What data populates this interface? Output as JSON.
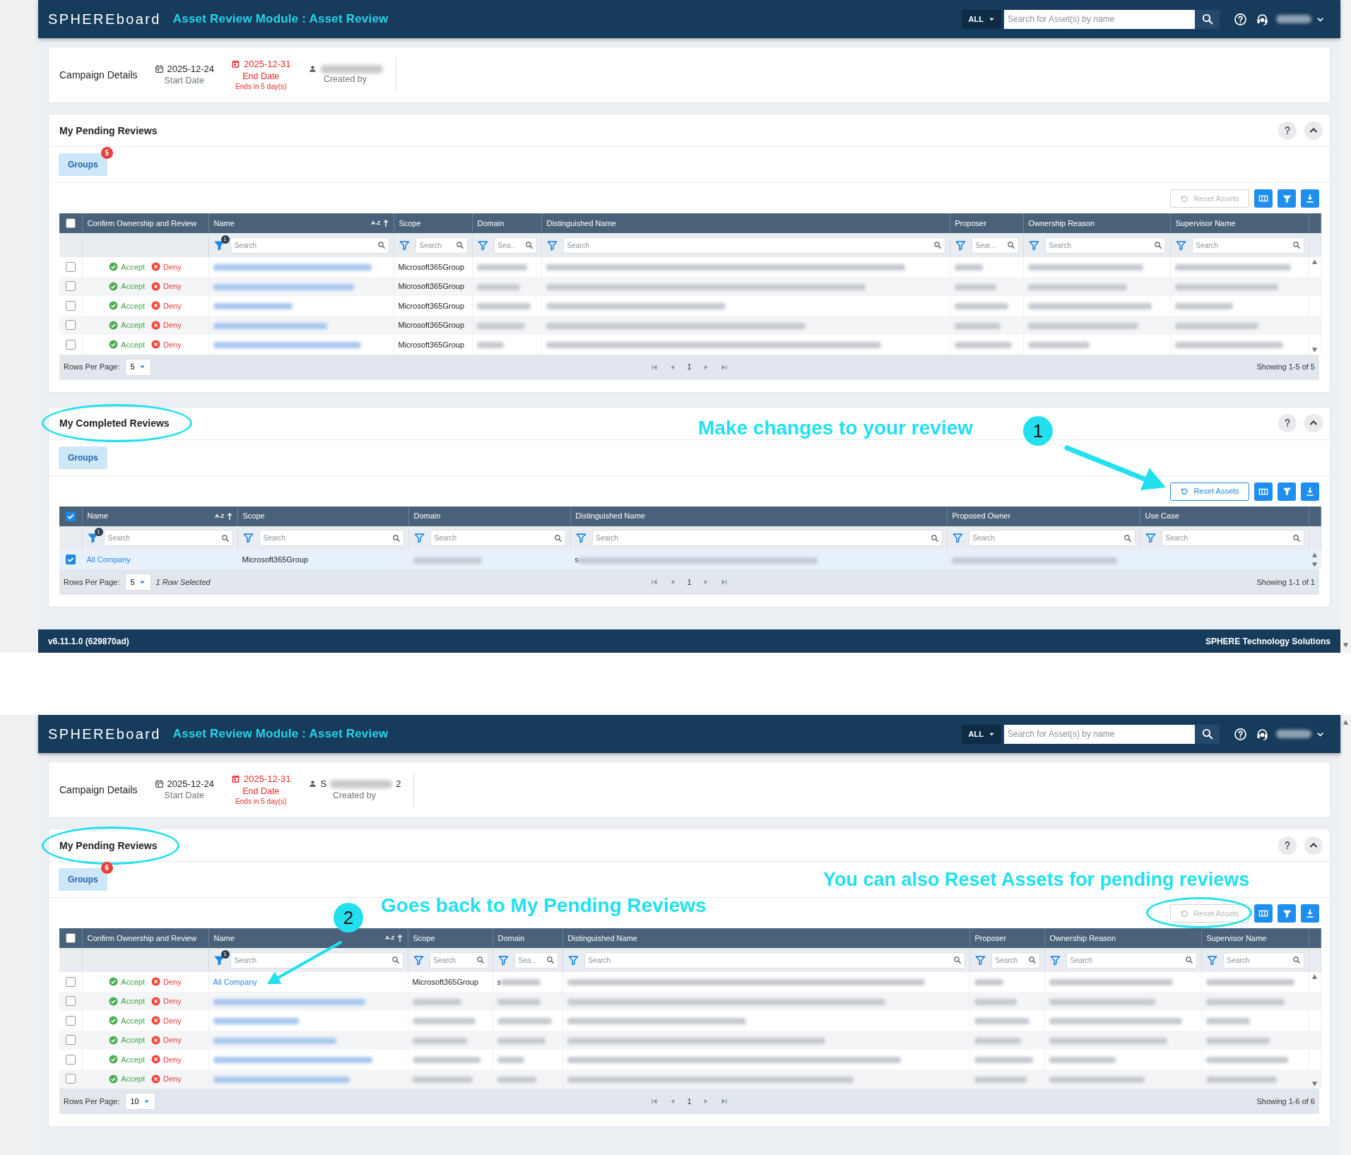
{
  "screens": [
    {
      "header": {
        "logo": "SPHEREboard",
        "module_title": "Asset Review Module : Asset Review",
        "scope": "ALL",
        "search": {
          "placeholder": "Search for Asset(s) by name"
        },
        "user": {
          "redacted": true
        }
      },
      "campaign": {
        "title": "Campaign Details",
        "start": {
          "date": "2025-12-24",
          "label": "Start Date"
        },
        "end": {
          "date": "2025-12-31",
          "label": "End Date",
          "note": "Ends in 5 day(s)"
        },
        "creator": {
          "redacted": true,
          "label": "Created by"
        }
      },
      "panels": [
        {
          "title": "My Pending Reviews",
          "title_highlighted": false,
          "tabs": [
            {
              "label": "Groups",
              "badge": "5",
              "selected": true
            }
          ],
          "reset_button": {
            "label": "Reset Assets",
            "disabled": true,
            "highlighted": false
          },
          "table": {
            "all_selected": false,
            "columns": [
              {
                "label": "Confirm Ownership and Review",
                "kind": "actions"
              },
              {
                "label": "Name",
                "kind": "link",
                "sort_label": "A-Z",
                "filter": {
                  "placeholder": "Search",
                  "count": "1"
                }
              },
              {
                "label": "Scope",
                "kind": "text",
                "filter": {
                  "placeholder": "Search"
                }
              },
              {
                "label": "Domain",
                "kind": "text",
                "filter": {
                  "placeholder": "Sea..."
                }
              },
              {
                "label": "Distinguished Name",
                "kind": "text",
                "filter": {
                  "placeholder": "Search"
                }
              },
              {
                "label": "Proposer",
                "kind": "text",
                "filter": {
                  "placeholder": "Sear..."
                }
              },
              {
                "label": "Ownership Reason",
                "kind": "text",
                "filter": {
                  "placeholder": "Search"
                }
              },
              {
                "label": "Supervisor Name",
                "kind": "text",
                "filter": {
                  "placeholder": "Search"
                }
              }
            ],
            "rows": [
              {
                "selected": false,
                "cells": [
                  {
                    "accept": "Accept",
                    "deny": "Deny"
                  },
                  {
                    "redacted": true
                  },
                  {
                    "text": "Microsoft365Group"
                  },
                  {
                    "redacted": true
                  },
                  {
                    "redacted": true
                  },
                  {
                    "redacted": true
                  },
                  {
                    "redacted": true
                  },
                  {
                    "redacted": true
                  }
                ]
              },
              {
                "selected": false,
                "cells": [
                  {
                    "accept": "Accept",
                    "deny": "Deny"
                  },
                  {
                    "redacted": true
                  },
                  {
                    "text": "Microsoft365Group"
                  },
                  {
                    "redacted": true
                  },
                  {
                    "redacted": true
                  },
                  {
                    "redacted": true
                  },
                  {
                    "redacted": true
                  },
                  {
                    "redacted": true
                  }
                ]
              },
              {
                "selected": false,
                "cells": [
                  {
                    "accept": "Accept",
                    "deny": "Deny"
                  },
                  {
                    "redacted": true
                  },
                  {
                    "text": "Microsoft365Group"
                  },
                  {
                    "redacted": true
                  },
                  {
                    "redacted": true
                  },
                  {
                    "redacted": true
                  },
                  {
                    "redacted": true
                  },
                  {
                    "redacted": true
                  }
                ]
              },
              {
                "selected": false,
                "cells": [
                  {
                    "accept": "Accept",
                    "deny": "Deny"
                  },
                  {
                    "redacted": true
                  },
                  {
                    "text": "Microsoft365Group"
                  },
                  {
                    "redacted": true
                  },
                  {
                    "redacted": true
                  },
                  {
                    "redacted": true
                  },
                  {
                    "redacted": true
                  },
                  {
                    "redacted": true
                  }
                ]
              },
              {
                "selected": false,
                "cells": [
                  {
                    "accept": "Accept",
                    "deny": "Deny"
                  },
                  {
                    "redacted": true
                  },
                  {
                    "text": "Microsoft365Group"
                  },
                  {
                    "redacted": true
                  },
                  {
                    "redacted": true
                  },
                  {
                    "redacted": true
                  },
                  {
                    "redacted": true
                  },
                  {
                    "redacted": true
                  }
                ]
              }
            ]
          },
          "footer": {
            "rows_per_page_label": "Rows Per Page:",
            "rows_per_page": "5",
            "page": "1",
            "showing": "Showing 1-5 of 5"
          }
        },
        {
          "title": "My Completed Reviews",
          "title_highlighted": true,
          "tabs": [
            {
              "label": "Groups",
              "selected": true
            }
          ],
          "reset_button": {
            "label": "Reset Assets",
            "disabled": false,
            "highlighted": false
          },
          "table": {
            "all_selected": true,
            "columns": [
              {
                "label": "Name",
                "kind": "link",
                "sort_label": "A-Z",
                "filter": {
                  "placeholder": "Search",
                  "count": "1"
                }
              },
              {
                "label": "Scope",
                "kind": "text",
                "filter": {
                  "placeholder": "Search"
                }
              },
              {
                "label": "Domain",
                "kind": "text",
                "filter": {
                  "placeholder": "Search"
                }
              },
              {
                "label": "Distinguished Name",
                "kind": "text",
                "filter": {
                  "placeholder": "Search"
                }
              },
              {
                "label": "Proposed Owner",
                "kind": "text",
                "filter": {
                  "placeholder": "Search"
                }
              },
              {
                "label": "Use Case",
                "kind": "text",
                "filter": {
                  "placeholder": "Search"
                }
              }
            ],
            "rows": [
              {
                "selected": true,
                "cells": [
                  {
                    "text": "All Company"
                  },
                  {
                    "text": "Microsoft365Group"
                  },
                  {
                    "redacted": true
                  },
                  {
                    "text": "s",
                    "redacted": true
                  },
                  {
                    "redacted": true
                  }
                ]
              }
            ]
          },
          "footer": {
            "rows_per_page_label": "Rows Per Page:",
            "rows_per_page": "5",
            "selection_note": "1 Row Selected",
            "page": "1",
            "showing": "Showing 1-1 of 1"
          }
        }
      ],
      "callouts": [
        {
          "text": "Make changes to your review",
          "step": "1"
        }
      ],
      "footer": {
        "version": "v6.11.1.0 (629870ad)",
        "company": "SPHERE Technology Solutions"
      }
    },
    {
      "header": {
        "logo": "SPHEREboard",
        "module_title": "Asset Review Module : Asset Review",
        "scope": "ALL",
        "search": {
          "placeholder": "Search for Asset(s) by name"
        },
        "user": {
          "redacted": true
        }
      },
      "campaign": {
        "title": "Campaign Details",
        "start": {
          "date": "2025-12-24",
          "label": "Start Date"
        },
        "end": {
          "date": "2025-12-31",
          "label": "End Date",
          "note": "Ends in 5 day(s)"
        },
        "creator": {
          "visible_start": "S",
          "redacted": true,
          "visible_end": "2",
          "label": "Created by"
        }
      },
      "panels": [
        {
          "title": "My Pending Reviews",
          "title_highlighted": true,
          "tabs": [
            {
              "label": "Groups",
              "badge": "6",
              "selected": true
            }
          ],
          "reset_button": {
            "label": "Reset Assets",
            "disabled": true,
            "highlighted": true
          },
          "table": {
            "all_selected": false,
            "columns": [
              {
                "label": "Confirm Ownership and Review",
                "kind": "actions"
              },
              {
                "label": "Name",
                "kind": "link",
                "sort_label": "A-Z",
                "filter": {
                  "placeholder": "Search",
                  "count": "1"
                }
              },
              {
                "label": "Scope",
                "kind": "text",
                "filter": {
                  "placeholder": "Search"
                }
              },
              {
                "label": "Domain",
                "kind": "text",
                "filter": {
                  "placeholder": "Sea..."
                }
              },
              {
                "label": "Distinguished Name",
                "kind": "text",
                "filter": {
                  "placeholder": "Search"
                }
              },
              {
                "label": "Proposer",
                "kind": "text",
                "filter": {
                  "placeholder": "Search"
                }
              },
              {
                "label": "Ownership Reason",
                "kind": "text",
                "filter": {
                  "placeholder": "Search"
                }
              },
              {
                "label": "Supervisor Name",
                "kind": "text",
                "filter": {
                  "placeholder": "Search"
                }
              }
            ],
            "rows": [
              {
                "selected": false,
                "cells": [
                  {
                    "accept": "Accept",
                    "deny": "Deny"
                  },
                  {
                    "text": "All Company"
                  },
                  {
                    "text": "Microsoft365Group"
                  },
                  {
                    "text": "s",
                    "redacted": true
                  },
                  {
                    "redacted": true
                  },
                  {
                    "redacted": true
                  },
                  {
                    "redacted": true
                  },
                  {
                    "redacted": true
                  }
                ]
              },
              {
                "selected": false,
                "cells": [
                  {
                    "accept": "Accept",
                    "deny": "Deny"
                  },
                  {
                    "redacted": true
                  },
                  {
                    "redacted": true
                  },
                  {
                    "redacted": true
                  },
                  {
                    "redacted": true
                  },
                  {
                    "redacted": true
                  },
                  {
                    "redacted": true
                  },
                  {
                    "redacted": true
                  }
                ]
              },
              {
                "selected": false,
                "cells": [
                  {
                    "accept": "Accept",
                    "deny": "Deny"
                  },
                  {
                    "redacted": true
                  },
                  {
                    "redacted": true
                  },
                  {
                    "redacted": true
                  },
                  {
                    "redacted": true
                  },
                  {
                    "redacted": true
                  },
                  {
                    "redacted": true
                  },
                  {
                    "redacted": true
                  }
                ]
              },
              {
                "selected": false,
                "cells": [
                  {
                    "accept": "Accept",
                    "deny": "Deny"
                  },
                  {
                    "redacted": true
                  },
                  {
                    "redacted": true
                  },
                  {
                    "redacted": true
                  },
                  {
                    "redacted": true
                  },
                  {
                    "redacted": true
                  },
                  {
                    "redacted": true
                  },
                  {
                    "redacted": true
                  }
                ]
              },
              {
                "selected": false,
                "cells": [
                  {
                    "accept": "Accept",
                    "deny": "Deny"
                  },
                  {
                    "redacted": true
                  },
                  {
                    "redacted": true
                  },
                  {
                    "redacted": true
                  },
                  {
                    "redacted": true
                  },
                  {
                    "redacted": true
                  },
                  {
                    "redacted": true
                  },
                  {
                    "redacted": true
                  }
                ]
              },
              {
                "selected": false,
                "cells": [
                  {
                    "accept": "Accept",
                    "deny": "Deny"
                  },
                  {
                    "redacted": true
                  },
                  {
                    "redacted": true
                  },
                  {
                    "redacted": true
                  },
                  {
                    "redacted": true
                  },
                  {
                    "redacted": true
                  },
                  {
                    "redacted": true
                  },
                  {
                    "redacted": true
                  }
                ]
              }
            ]
          },
          "footer": {
            "rows_per_page_label": "Rows Per Page:",
            "rows_per_page": "10",
            "page": "1",
            "showing": "Showing 1-6 of 6"
          }
        }
      ],
      "callouts": [
        {
          "text": "You can also Reset Assets for pending reviews"
        },
        {
          "text": "Goes back to My Pending Reviews",
          "step": "2"
        }
      ]
    }
  ]
}
